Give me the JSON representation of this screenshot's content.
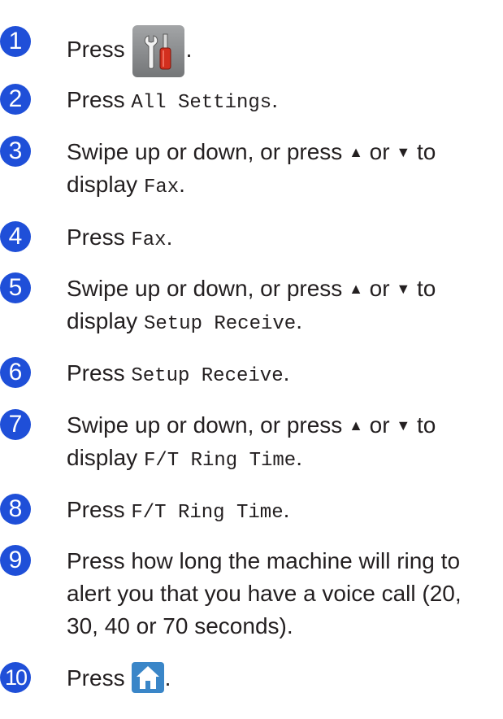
{
  "steps": [
    {
      "number": "1",
      "press": "Press",
      "end": "."
    },
    {
      "number": "2",
      "press": "Press",
      "setting": "All Settings",
      "end": "."
    },
    {
      "number": "3",
      "pre": "Swipe up or down, or press",
      "up_glyph": "▲",
      "or": "or",
      "down_glyph": "▼",
      "to": "to",
      "display": "display",
      "setting": "Fax",
      "end": "."
    },
    {
      "number": "4",
      "press": "Press",
      "setting": "Fax",
      "end": "."
    },
    {
      "number": "5",
      "pre": "Swipe up or down, or press",
      "up_glyph": "▲",
      "or": "or",
      "down_glyph": "▼",
      "to": "to",
      "display": "display",
      "setting": "Setup Receive",
      "end": "."
    },
    {
      "number": "6",
      "press": "Press",
      "setting": "Setup Receive",
      "end": "."
    },
    {
      "number": "7",
      "pre": "Swipe up or down, or press",
      "up_glyph": "▲",
      "or": "or",
      "down_glyph": "▼",
      "to": "to",
      "display": "display",
      "setting": "F/T Ring Time",
      "end": "."
    },
    {
      "number": "8",
      "press": "Press",
      "setting": "F/T Ring Time",
      "end": "."
    },
    {
      "number": "9",
      "line1": "Press how long the machine will ring to",
      "line2": "alert you that you have a voice call (20,",
      "line3": "30, 40 or 70 seconds)."
    },
    {
      "number": "10",
      "press": "Press",
      "end": "."
    }
  ],
  "icons": {
    "settings_button": "tools-settings-icon",
    "home_button": "home-icon"
  },
  "colors": {
    "step_circle": "#1f4fd8",
    "text": "#231f20",
    "settings_button_bg": "#8a8c8e",
    "home_button_bg": "#3a86c8"
  }
}
